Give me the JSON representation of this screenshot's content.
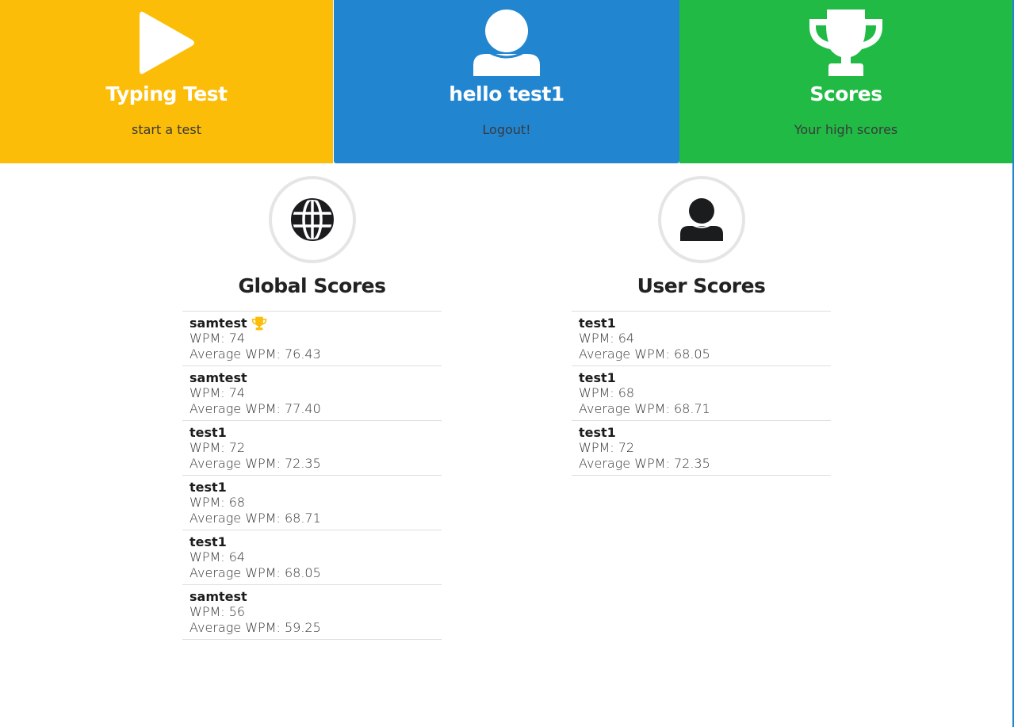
{
  "nav": {
    "typing": {
      "title": "Typing Test",
      "subtitle": "start a test",
      "icon": "play-icon",
      "color": "#fbbd08"
    },
    "user": {
      "title": "hello test1",
      "subtitle": "Logout!",
      "icon": "user-icon",
      "color": "#2185d0"
    },
    "scores": {
      "title": "Scores",
      "subtitle": "Your high scores",
      "icon": "trophy-icon",
      "color": "#21ba45"
    }
  },
  "global": {
    "heading": "Global Scores",
    "icon": "globe-icon",
    "items": [
      {
        "name": "samtest",
        "wpm": "WPM: 74",
        "avg": "Average WPM: 76.43",
        "badge": "trophy-icon"
      },
      {
        "name": "samtest",
        "wpm": "WPM: 74",
        "avg": "Average WPM: 77.40"
      },
      {
        "name": "test1",
        "wpm": "WPM: 72",
        "avg": "Average WPM: 72.35"
      },
      {
        "name": "test1",
        "wpm": "WPM: 68",
        "avg": "Average WPM: 68.71"
      },
      {
        "name": "test1",
        "wpm": "WPM: 64",
        "avg": "Average WPM: 68.05"
      },
      {
        "name": "samtest",
        "wpm": "WPM: 56",
        "avg": "Average WPM: 59.25"
      }
    ]
  },
  "user": {
    "heading": "User Scores",
    "icon": "user-icon",
    "items": [
      {
        "name": "test1",
        "wpm": "WPM: 64",
        "avg": "Average WPM: 68.05"
      },
      {
        "name": "test1",
        "wpm": "WPM: 68",
        "avg": "Average WPM: 68.71"
      },
      {
        "name": "test1",
        "wpm": "WPM: 72",
        "avg": "Average WPM: 72.35"
      }
    ]
  },
  "colors": {
    "gold": "#fbbd08",
    "circle_border": "#e5e5e5",
    "divider": "#dedede"
  }
}
